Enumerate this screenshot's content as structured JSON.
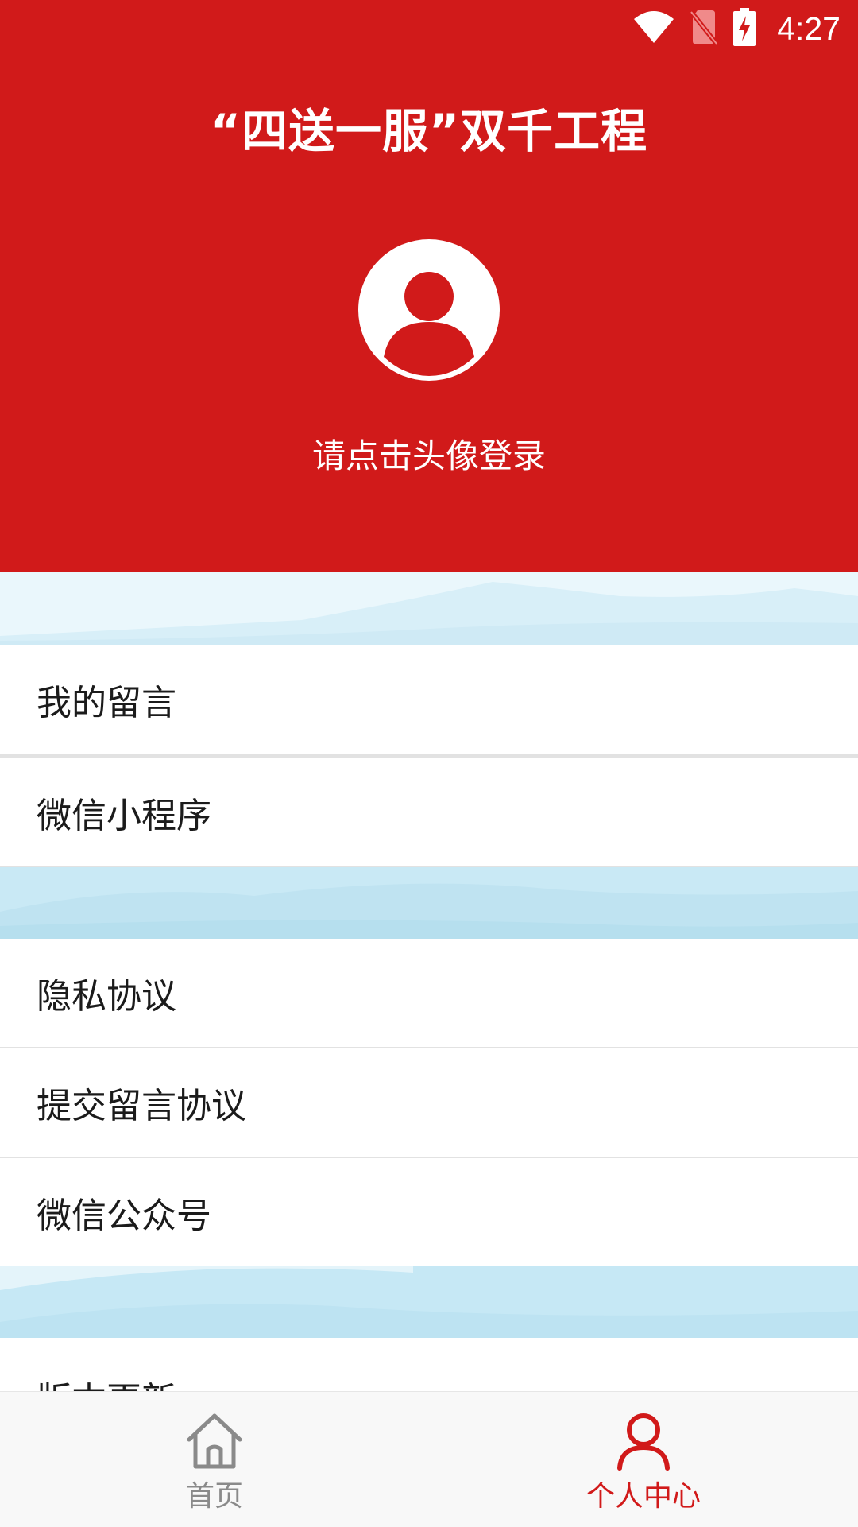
{
  "status_bar": {
    "time": "4:27",
    "icons": [
      "wifi-icon",
      "no-sim-icon",
      "battery-charging-icon"
    ]
  },
  "header": {
    "title": "“四送一服”双千工程",
    "login_hint": "请点击头像登录",
    "avatar_icon": "user-avatar-icon"
  },
  "menu": {
    "items": [
      {
        "label": "我的留言"
      },
      {
        "label": "微信小程序"
      },
      {
        "label": "隐私协议"
      },
      {
        "label": "提交留言协议"
      },
      {
        "label": "微信公众号"
      },
      {
        "label": "版本更新"
      }
    ]
  },
  "tabbar": {
    "tabs": [
      {
        "label": "首页",
        "icon": "home-icon",
        "active": false
      },
      {
        "label": "个人中心",
        "icon": "person-icon",
        "active": true
      }
    ]
  },
  "colors": {
    "brand_red": "#d11a1a",
    "inactive_gray": "#8a8a8a",
    "band_blue": "#c9e9f5"
  }
}
